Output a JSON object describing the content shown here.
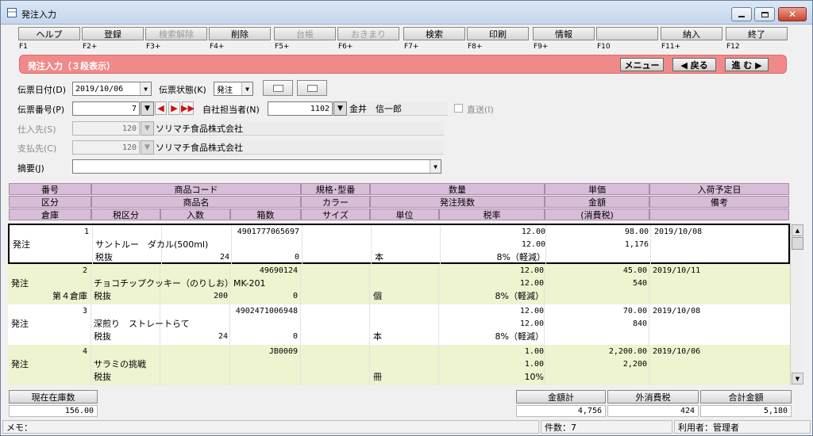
{
  "window": {
    "title": "発注入力"
  },
  "fkeys": [
    {
      "label": "ヘルプ",
      "key": "F1",
      "disabled": false
    },
    {
      "label": "登録",
      "key": "F2+",
      "disabled": false
    },
    {
      "label": "検索解除",
      "key": "F3+",
      "disabled": true
    },
    {
      "label": "削除",
      "key": "F4+",
      "disabled": false
    },
    {
      "label": "台帳",
      "key": "F5+",
      "disabled": true
    },
    {
      "label": "おきまり",
      "key": "F6+",
      "disabled": true
    },
    {
      "label": "検索",
      "key": "F7+",
      "disabled": false
    },
    {
      "label": "印刷",
      "key": "F8+",
      "disabled": false
    },
    {
      "label": "情報",
      "key": "F9+",
      "disabled": false
    },
    {
      "label": "",
      "key": "F10",
      "disabled": false
    },
    {
      "label": "納入",
      "key": "F11+",
      "disabled": false
    },
    {
      "label": "終了",
      "key": "F12",
      "disabled": false
    }
  ],
  "banner": {
    "title": "発注入力（３段表示）",
    "menu": "メニュー",
    "back": "◀ 戻る",
    "forward": "進 む ▶"
  },
  "form": {
    "date_label": "伝票日付(D)",
    "date_value": "2019/10/06",
    "status_label": "伝票状態(K)",
    "status_value": "発注",
    "number_label": "伝票番号(P)",
    "number_value": "7",
    "staff_label": "自社担当者(N)",
    "staff_code": "1102",
    "staff_name": "金井　信一郎",
    "direct_label": "直送(I)",
    "supplier_label": "仕入先(S)",
    "supplier_code": "120",
    "supplier_name": "ソリマチ食品株式会社",
    "payee_label": "支払先(C)",
    "payee_code": "120",
    "payee_name": "ソリマチ食品株式会社",
    "memo_label": "摘要(J)",
    "memo_value": ""
  },
  "headers": {
    "row1": [
      "番号",
      "商品コード",
      "規格･型番",
      "数量",
      "単価",
      "入荷予定日"
    ],
    "row2": [
      "区分",
      "商品名",
      "カラー",
      "発注残数",
      "金額",
      "備考"
    ],
    "row3": [
      "倉庫",
      "税区分",
      "入数",
      "箱数",
      "サイズ",
      "単位",
      "税率",
      "(消費税)"
    ]
  },
  "records": [
    {
      "no": "1",
      "code": "4901777065697",
      "qty": "12.00",
      "price": "98.00",
      "date": "2019/10/08",
      "kubun": "発注",
      "name": "サントルー　ダカル(500ml)",
      "remain": "12.00",
      "amount": "1,176",
      "warehouse": "",
      "tax": "税抜",
      "irisu": "24",
      "hako": "0",
      "unit": "本",
      "rate": "8%（軽減）"
    },
    {
      "no": "2",
      "code": "49690124",
      "qty": "12.00",
      "price": "45.00",
      "date": "2019/10/11",
      "kubun": "発注",
      "name": "チョコチップクッキー（のりしお）MK-201",
      "remain": "12.00",
      "amount": "540",
      "warehouse": "第４倉庫",
      "tax": "税抜",
      "irisu": "200",
      "hako": "0",
      "unit": "個",
      "rate": "8%（軽減）"
    },
    {
      "no": "3",
      "code": "4902471006948",
      "qty": "12.00",
      "price": "70.00",
      "date": "2019/10/08",
      "kubun": "発注",
      "name": "深煎り　ストレートらて",
      "remain": "12.00",
      "amount": "840",
      "warehouse": "",
      "tax": "税抜",
      "irisu": "24",
      "hako": "0",
      "unit": "本",
      "rate": "8%（軽減）"
    },
    {
      "no": "4",
      "code": "JB0009",
      "qty": "1.00",
      "price": "2,200.00",
      "date": "2019/10/06",
      "kubun": "発注",
      "name": "サラミの挑戦",
      "remain": "1.00",
      "amount": "2,200",
      "warehouse": "",
      "tax": "税抜",
      "irisu": "",
      "hako": "",
      "unit": "冊",
      "rate": "10%"
    }
  ],
  "summary": {
    "stock_label": "現在在庫数",
    "stock_value": "156.00",
    "total_label": "金額計",
    "total_value": "4,756",
    "tax_label": "外消費税",
    "tax_value": "424",
    "grand_label": "合計金額",
    "grand_value": "5,180"
  },
  "status": {
    "memo": "メモ：",
    "count": "件数：7",
    "user": "利用者：管理者"
  }
}
